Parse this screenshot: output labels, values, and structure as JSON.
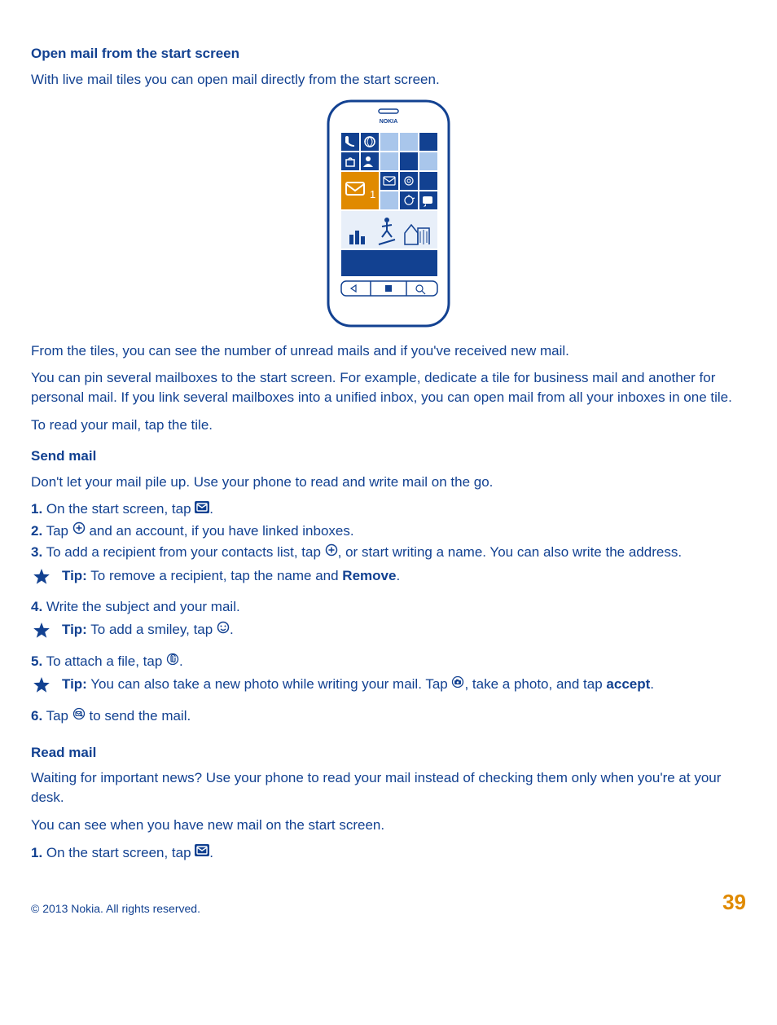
{
  "section1": {
    "heading": "Open mail from the start screen",
    "p1": "With live mail tiles you can open mail directly from the start screen.",
    "p2": "From the tiles, you can see the number of unread mails and if you've received new mail.",
    "p3": "You can pin several mailboxes to the start screen. For example, dedicate a tile for business mail and another for personal mail. If you link several mailboxes into a unified inbox, you can open mail from all your inboxes in one tile.",
    "p4": "To read your mail, tap the tile."
  },
  "section2": {
    "heading": "Send mail",
    "p1": "Don't let your mail pile up. Use your phone to read and write mail on the go.",
    "step1": {
      "num": "1.",
      "text_before": " On the start screen, tap ",
      "after": "."
    },
    "step2": {
      "num": "2.",
      "before": " Tap ",
      "after": " and an account, if you have linked inboxes."
    },
    "step3": {
      "num": "3.",
      "before": " To add a recipient from your contacts list, tap ",
      "after": ", or start writing a name. You can also write the address."
    },
    "tip1": {
      "label": "Tip:",
      "before": " To remove a recipient, tap the name and ",
      "bold": "Remove",
      "after": "."
    },
    "step4": {
      "num": "4.",
      "text": " Write the subject and your mail."
    },
    "tip2": {
      "label": "Tip:",
      "before": " To add a smiley, tap ",
      "after": "."
    },
    "step5": {
      "num": "5.",
      "before": " To attach a file, tap ",
      "after": "."
    },
    "tip3": {
      "label": "Tip:",
      "before": " You can also take a new photo while writing your mail. Tap ",
      "mid": ", take a photo, and tap ",
      "bold": "accept",
      "after": "."
    },
    "step6": {
      "num": "6.",
      "before": " Tap ",
      "after": " to send the mail."
    }
  },
  "section3": {
    "heading": "Read mail",
    "p1": "Waiting for important news? Use your phone to read your mail instead of checking them only when you're at your desk.",
    "p2": "You can see when you have new mail on the start screen.",
    "step1": {
      "num": "1.",
      "before": " On the start screen, tap ",
      "after": "."
    }
  },
  "footer": {
    "copyright": "© 2013 Nokia. All rights reserved.",
    "page": "39"
  },
  "phone": {
    "brand": "NOKIA",
    "mail_count": "1"
  }
}
